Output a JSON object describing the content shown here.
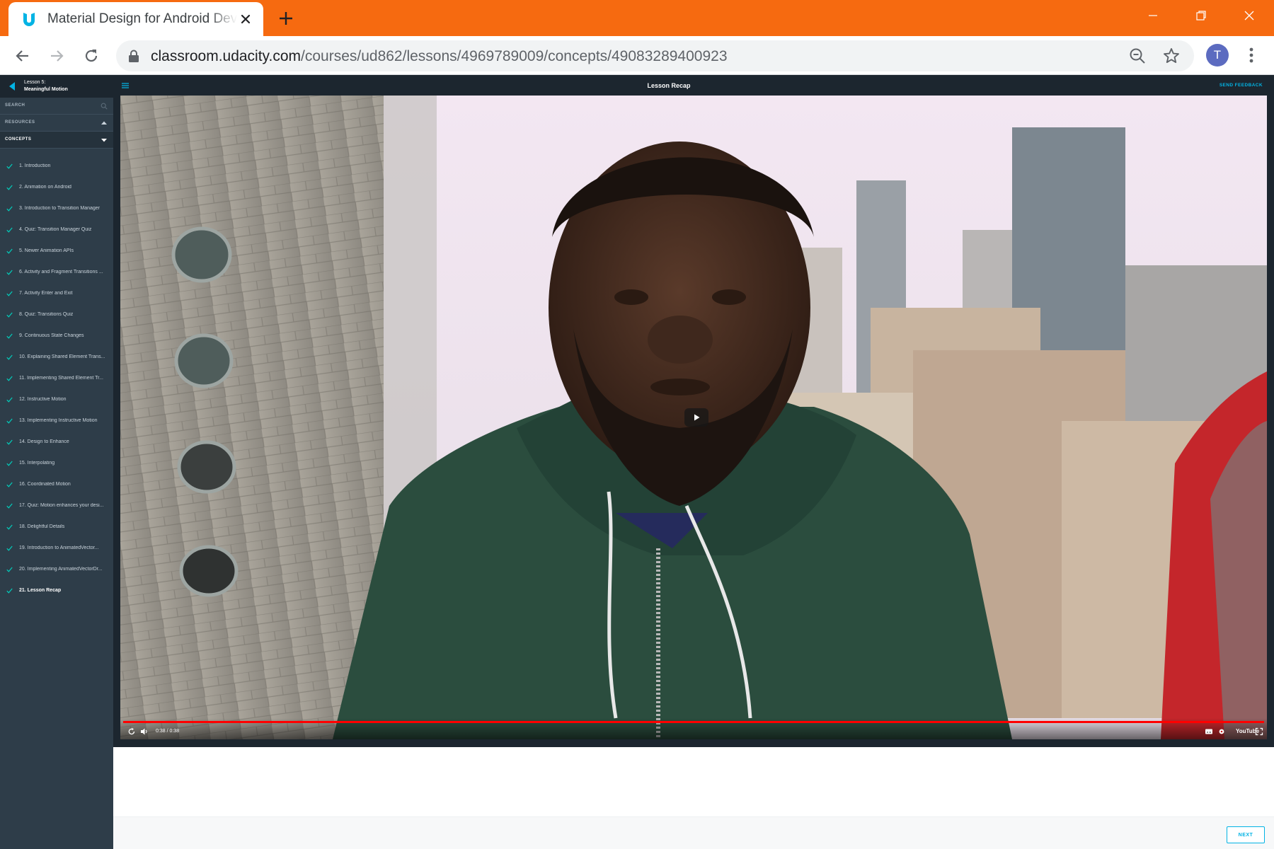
{
  "browser": {
    "tab_title": "Material Design for Android Developers",
    "url_host": "classroom.udacity.com",
    "url_path": "/courses/ud862/lessons/4969789009/concepts/49083289400923",
    "avatar_letter": "T",
    "theme_color": "#f66a10"
  },
  "sidebar": {
    "lesson_number": "Lesson 5:",
    "lesson_name": "Meaningful Motion",
    "search_label": "SEARCH",
    "resources_label": "RESOURCES",
    "concepts_label": "CONCEPTS",
    "concepts": [
      {
        "label": "1. Introduction",
        "done": true
      },
      {
        "label": "2. Animation on Android",
        "done": true
      },
      {
        "label": "3. Introduction to Transition Manager",
        "done": true
      },
      {
        "label": "4. Quiz: Transition Manager Quiz",
        "done": true
      },
      {
        "label": "5. Newer Animation APIs",
        "done": true
      },
      {
        "label": "6. Activity and Fragment Transitions ...",
        "done": true
      },
      {
        "label": "7. Activity Enter and Exit",
        "done": true
      },
      {
        "label": "8. Quiz: Transitions Quiz",
        "done": true
      },
      {
        "label": "9. Continuous State Changes",
        "done": true
      },
      {
        "label": "10. Explaining Shared Element Trans...",
        "done": true
      },
      {
        "label": "11. Implementing Shared Element Tr...",
        "done": true
      },
      {
        "label": "12. Instructive Motion",
        "done": true
      },
      {
        "label": "13. Implementing Instructive Motion",
        "done": true
      },
      {
        "label": "14. Design to Enhance",
        "done": true
      },
      {
        "label": "15. Interpolating",
        "done": true
      },
      {
        "label": "16. Coordinated Motion",
        "done": true
      },
      {
        "label": "17. Quiz: Motion enhances your desi...",
        "done": true
      },
      {
        "label": "18. Delightful Details",
        "done": true
      },
      {
        "label": "19. Introduction to AnimatedVector...",
        "done": true
      },
      {
        "label": "20. Implementing AnimatedVectorDr...",
        "done": true
      },
      {
        "label": "21. Lesson Recap",
        "done": true,
        "current": true
      }
    ],
    "accent_color": "#02b3e4",
    "check_color": "#02ccba"
  },
  "main": {
    "concept_title": "Lesson Recap",
    "feedback_label": "SEND FEEDBACK",
    "next_label": "NEXT"
  },
  "video": {
    "timecode": "0:38 / 0:38",
    "provider": "YouTube",
    "progress": 1.0
  }
}
